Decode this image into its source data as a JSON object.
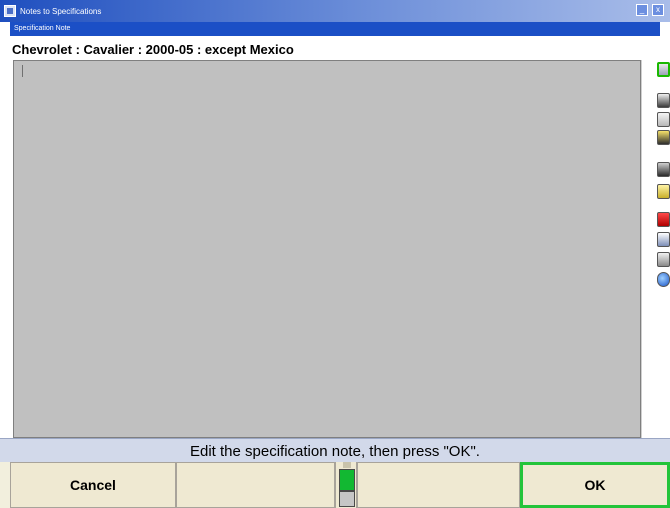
{
  "window": {
    "title": "Notes to Specifications",
    "subtitle": "Specification Note",
    "controls": {
      "minimize": "_",
      "close": "x"
    }
  },
  "vehicle": {
    "title": "Chevrolet : Cavalier : 2000-05 : except Mexico"
  },
  "editor": {
    "content": ""
  },
  "toolbar": {
    "icons": [
      "wrench-icon",
      "document-icon",
      "clipboard-icon",
      "camera-icon",
      "tire-icon",
      "save-icon",
      "red-tool-icon",
      "monitor-icon",
      "printer-icon",
      "globe-icon"
    ],
    "active_index": 0
  },
  "status": {
    "text": "Edit the specification note, then press \"OK\"."
  },
  "buttons": {
    "cancel": "Cancel",
    "f2": "",
    "f3": "",
    "ok": "OK"
  },
  "colors": {
    "titlebar": "#1f4fbf",
    "editor_bg": "#c0c0c0",
    "status_bg": "#d2d9ea",
    "button_bg": "#efe9d2",
    "ok_border": "#23c43a",
    "indicator_green": "#12b832"
  }
}
